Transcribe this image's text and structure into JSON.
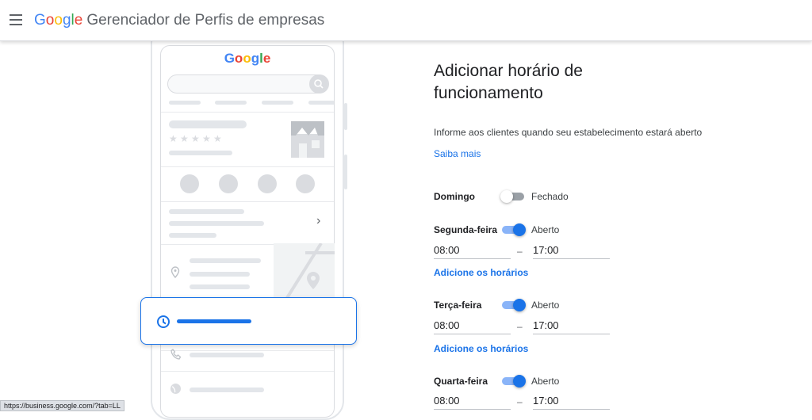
{
  "header": {
    "logo": [
      "G",
      "o",
      "o",
      "g",
      "l",
      "e"
    ],
    "product": "Gerenciador de Perfis de empresas"
  },
  "illustration": {
    "logo": [
      "G",
      "o",
      "o",
      "g",
      "l",
      "e"
    ],
    "stars": [
      "★",
      "★",
      "★",
      "★",
      "★"
    ],
    "chevron": "›"
  },
  "panel": {
    "title": "Adicionar horário de funcionamento",
    "description": "Informe aos clientes quando seu estabelecimento estará aberto",
    "learn_more": "Saiba mais",
    "days": [
      {
        "name": "Domingo",
        "state": "Fechado",
        "open": null
      },
      {
        "name": "Segunda-feira",
        "state": "Aberto",
        "open": "08:00",
        "close": "17:00",
        "add_hours": "Adicione os horários"
      },
      {
        "name": "Terça-feira",
        "state": "Aberto",
        "open": "08:00",
        "close": "17:00",
        "add_hours": "Adicione os horários"
      },
      {
        "name": "Quarta-feira",
        "state": "Aberto",
        "open": "08:00",
        "close": "17:00"
      }
    ],
    "dash": "–"
  },
  "status_bar": {
    "url": "https://business.google.com/?tab=LL"
  },
  "colors": {
    "accent": "#1a73e8",
    "toggle_on_track": "#8ab4f8",
    "toggle_off_track": "#9aa0a6"
  }
}
